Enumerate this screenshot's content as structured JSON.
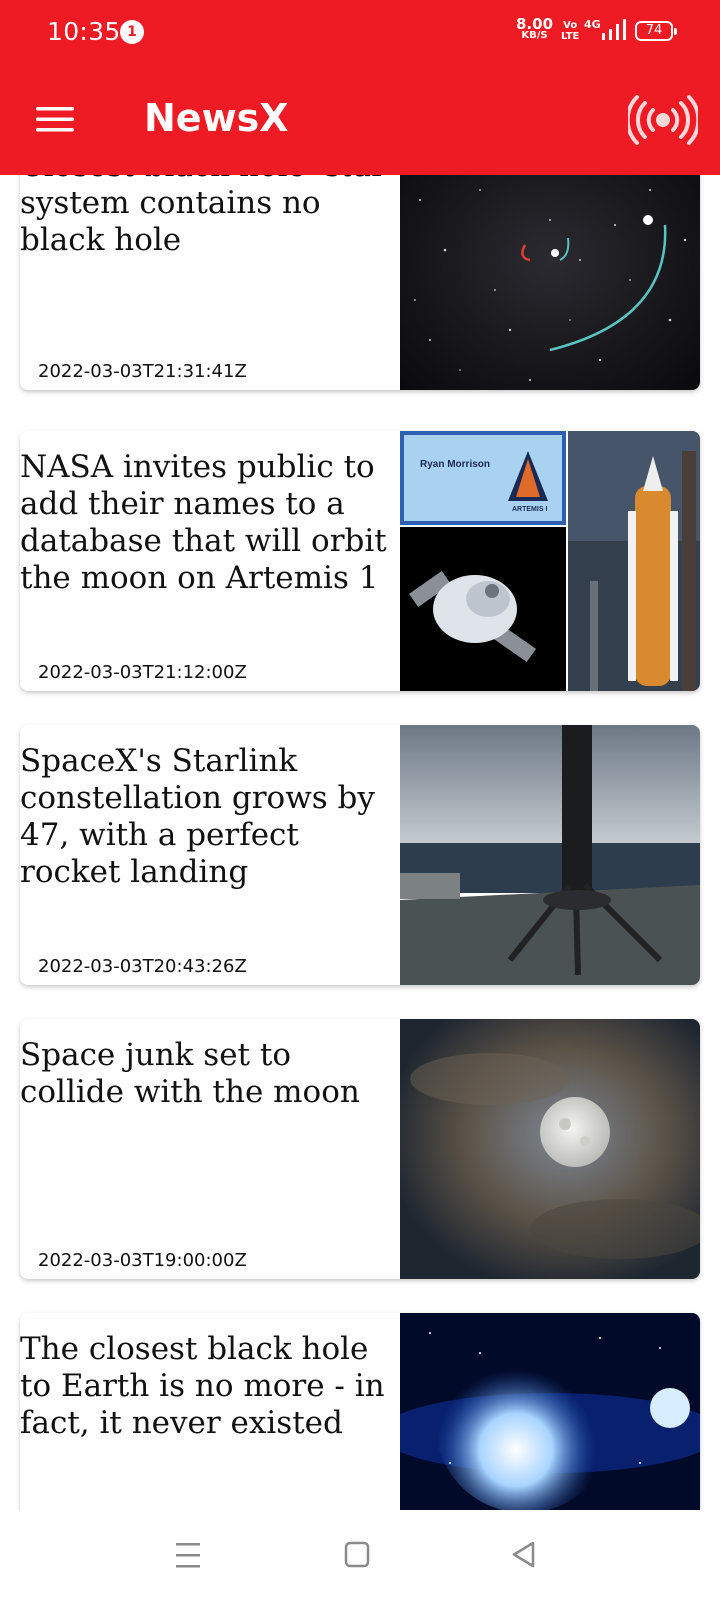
{
  "status_bar": {
    "time": "10:35",
    "notification_count": "1",
    "speed_value": "8.00",
    "speed_unit": "KB/S",
    "volte_top": "Vo",
    "volte_bottom": "LTE",
    "network": "4G",
    "battery": "74"
  },
  "app_bar": {
    "title": "NewsX",
    "menu_icon": "hamburger-menu-icon",
    "live_icon": "broadcast-icon"
  },
  "colors": {
    "primary": "#ee1b24",
    "background": "#ffffff",
    "text": "#111111"
  },
  "articles": [
    {
      "title": "Closest black hole 'star system contains no black hole",
      "date": "2022-03-03T21:31:41Z",
      "image": "black-hole-orbit-image"
    },
    {
      "title": "NASA invites public to add their names to a database that will orbit the moon on Artemis 1",
      "date": "2022-03-03T21:12:00Z",
      "image": "artemis-collage-image"
    },
    {
      "title": "SpaceX's Starlink constellation grows by 47, with a perfect rocket landing",
      "date": "2022-03-03T20:43:26Z",
      "image": "rocket-landing-image"
    },
    {
      "title": "Space junk set to collide with the moon",
      "date": "2022-03-03T19:00:00Z",
      "image": "moon-clouds-image"
    },
    {
      "title": "The closest black hole to Earth is no more - in fact, it never existed",
      "date": "",
      "image": "stars-image"
    }
  ],
  "artemis_card": {
    "name": "Ryan Morrison",
    "mission": "ARTEMIS I"
  },
  "nav_bar": {
    "recents": "recents-icon",
    "home": "home-icon",
    "back": "back-icon"
  }
}
